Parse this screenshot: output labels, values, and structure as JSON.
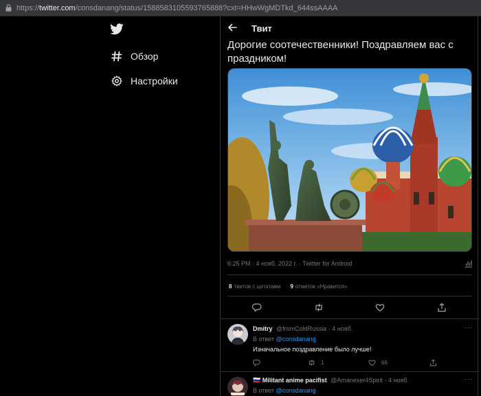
{
  "browser": {
    "url_prefix": "https://",
    "url_domain": "twitter.com",
    "url_path": "/consdanang/status/1588583105593765888?cxt=HHwWgMDTkd_644ssAAAA"
  },
  "sidebar": {
    "logo_icon": "twitter-bird-icon",
    "items": [
      {
        "label": "Обзор",
        "icon": "hashtag-icon"
      },
      {
        "label": "Настройки",
        "icon": "gear-icon"
      }
    ]
  },
  "header": {
    "title": "Твит"
  },
  "tweet": {
    "text": "Дорогие соотечественники! Поздравляем вас с праздником!",
    "timestamp": "6:25 PM · 4 нояб. 2022 г. · Twitter for Android",
    "stats": {
      "quotes_count": "8",
      "quotes_label": "твитов с цитатами",
      "likes_count": "9",
      "likes_label": "отметок «Нравится»"
    }
  },
  "replies": [
    {
      "name": "Dmitry",
      "handle": "@fromColdRussia",
      "sep": "·",
      "date": "4 нояб.",
      "in_reply_prefix": "В ответ",
      "in_reply_handle": "@consdanang",
      "text": "Изначальное поздравление было лучше!",
      "retweets": "1",
      "likes": "66"
    },
    {
      "name_flag": "🇷🇺",
      "name": "Militant anime pacifist",
      "handle": "@Amaneser4Spirit",
      "sep": "·",
      "date": "4 нояб.",
      "in_reply_prefix": "В ответ",
      "in_reply_handle": "@consdanang"
    }
  ],
  "more_label": "···",
  "colors": {
    "accent": "#1d9bf0",
    "background": "#000000",
    "muted": "#71767b",
    "border": "#2f3336"
  }
}
